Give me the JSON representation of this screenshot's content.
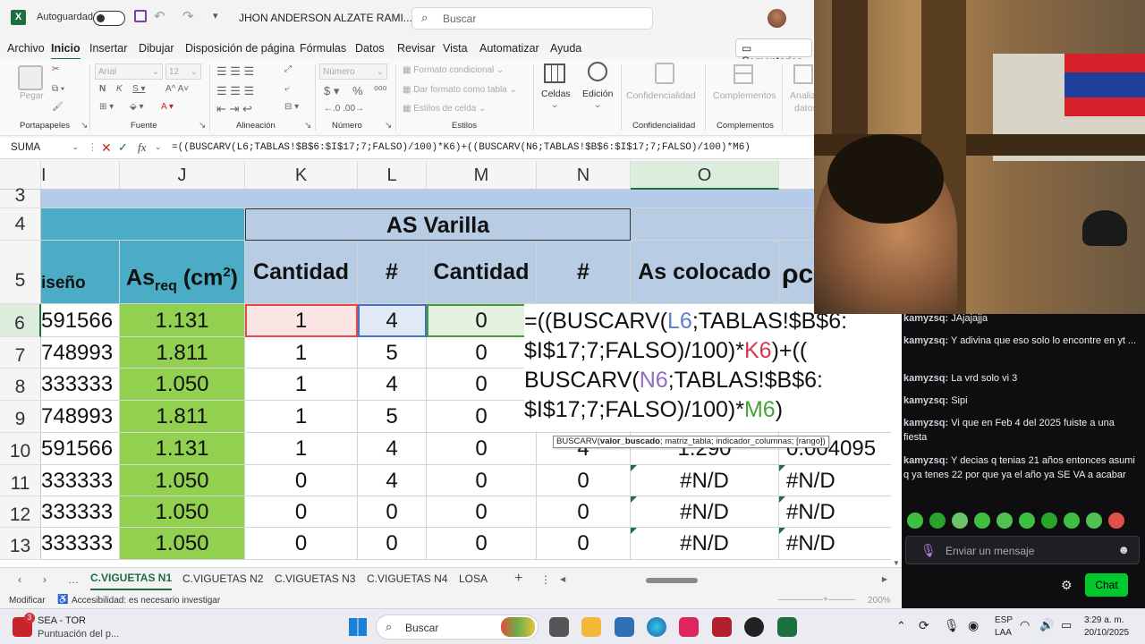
{
  "titlebar": {
    "autosave_label": "Autoguardado",
    "doc_title": "JHON ANDERSON ALZATE RAMI...",
    "search_placeholder": "Buscar"
  },
  "menu": [
    "Archivo",
    "Inicio",
    "Insertar",
    "Dibujar",
    "Disposición de página",
    "Fórmulas",
    "Datos",
    "Revisar",
    "Vista",
    "Automatizar",
    "Ayuda"
  ],
  "menu_active": "Inicio",
  "comments_label": "Comentarios",
  "ribbon": {
    "paste": "Pegar",
    "clipboard_group": "Portapapeles",
    "font_name": "Arial",
    "font_size": "12",
    "font_group": "Fuente",
    "align_group": "Alineación",
    "number_format": "Número",
    "number_group": "Número",
    "cond_format": "Formato condicional",
    "table_format": "Dar formato como tabla",
    "cell_styles": "Estilos de celda",
    "styles_group": "Estilos",
    "cells": "Celdas",
    "editing": "Edición",
    "confidentiality": "Confidencialidad",
    "confidentiality_group": "Confidencialidad",
    "addins": "Complementos",
    "addins_group": "Complementos",
    "analyze_1": "Analiz",
    "analyze_2": "datos"
  },
  "formula_bar": {
    "name_box": "SUMA",
    "formula": "=((BUSCARV(L6;TABLAS!$B$6:$I$17;7;FALSO)/100)*K6)+((BUSCARV(N6;TABLAS!$B$6:$I$17;7;FALSO)/100)*M6)"
  },
  "columns": [
    "I",
    "J",
    "K",
    "L",
    "M",
    "N",
    "O"
  ],
  "header": {
    "as_varilla": "AS Varilla",
    "diseno": "iseño",
    "asreq": "As",
    "asreq_sub": "req",
    "asreq_unit": "(cm",
    "asreq_sup": "2",
    "asreq_close": ")",
    "cantidad": "Cantidad",
    "hash": "#",
    "as_colocado": "As colocado",
    "rho": "ρc"
  },
  "rows": [
    {
      "num": "6",
      "i": "591566",
      "j": "1.131",
      "k": "1",
      "l": "4",
      "m": "0",
      "n": "",
      "o": "",
      "p": ""
    },
    {
      "num": "7",
      "i": "748993",
      "j": "1.811",
      "k": "1",
      "l": "5",
      "m": "0",
      "n": "",
      "o": "",
      "p": ""
    },
    {
      "num": "8",
      "i": "333333",
      "j": "1.050",
      "k": "1",
      "l": "4",
      "m": "0",
      "n": "",
      "o": "",
      "p": ""
    },
    {
      "num": "9",
      "i": "748993",
      "j": "1.811",
      "k": "1",
      "l": "5",
      "m": "0",
      "n": "",
      "o": "",
      "p": ""
    },
    {
      "num": "10",
      "i": "591566",
      "j": "1.131",
      "k": "1",
      "l": "4",
      "m": "0",
      "n": "4",
      "o": "1.290",
      "p": "0.004095"
    },
    {
      "num": "11",
      "i": "333333",
      "j": "1.050",
      "k": "0",
      "l": "4",
      "m": "0",
      "n": "0",
      "o": "#N/D",
      "p": "#N/D"
    },
    {
      "num": "12",
      "i": "333333",
      "j": "1.050",
      "k": "0",
      "l": "0",
      "m": "0",
      "n": "0",
      "o": "#N/D",
      "p": "#N/D"
    },
    {
      "num": "13",
      "i": "333333",
      "j": "1.050",
      "k": "0",
      "l": "0",
      "m": "0",
      "n": "0",
      "o": "#N/D",
      "p": "#N/D"
    }
  ],
  "row_labels_top": [
    "3",
    "4",
    "5"
  ],
  "editor": {
    "line1_a": "=((BUSCARV(",
    "line1_ref": "L6",
    "line1_b": ";TABLAS!$B$6:",
    "line2_a": "$I$17;7;FALSO)/100)*",
    "line2_ref": "K6",
    "line2_b": ")+((",
    "line3_a": "BUSCARV(",
    "line3_ref": "N6",
    "line3_b": ";TABLAS!$B$6:",
    "line4_a": "$I$17;7;FALSO)/100)*",
    "line4_ref": "M6",
    "line4_b": ")"
  },
  "tooltip": {
    "fn": "BUSCARV(",
    "arg1": "valor_buscado",
    "rest": "; matriz_tabla; indicador_columnas; [rango])"
  },
  "sheets": [
    "C.VIGUETAS N1",
    "C.VIGUETAS N2",
    "C.VIGUETAS N3",
    "C.VIGUETAS N4",
    "LOSA"
  ],
  "active_sheet": "C.VIGUETAS N1",
  "status": {
    "mode": "Modificar",
    "accessibility": "Accesibilidad: es necesario investigar",
    "zoom": "200%"
  },
  "chat": {
    "messages": [
      {
        "user": "kamyzsq:",
        "text": "JAjajajja"
      },
      {
        "user": "kamyzsq:",
        "text": "Y adivina que eso solo lo encontre en yt ..."
      },
      {
        "user": "kamyzsq:",
        "text": "La vrd solo vi 3"
      },
      {
        "user": "kamyzsq:",
        "text": "Sipi"
      },
      {
        "user": "kamyzsq:",
        "text": "Vi que en Feb 4 del 2025 fuiste a una fiesta"
      },
      {
        "user": "kamyzsq:",
        "text": "Y decias q tenias 21 años entonces asumi q ya tenes 22 por que ya el año ya SE VA a acabar"
      }
    ],
    "input_placeholder": "Enviar un mensaje",
    "chat_button": "Chat"
  },
  "taskbar": {
    "app_title": "SEA - TOR",
    "app_subtitle": "Puntuación del p...",
    "badge": "3",
    "search_placeholder": "Buscar",
    "lang_1": "ESP",
    "lang_2": "LAA",
    "time": "3:29 a. m.",
    "date": "20/10/2025"
  }
}
